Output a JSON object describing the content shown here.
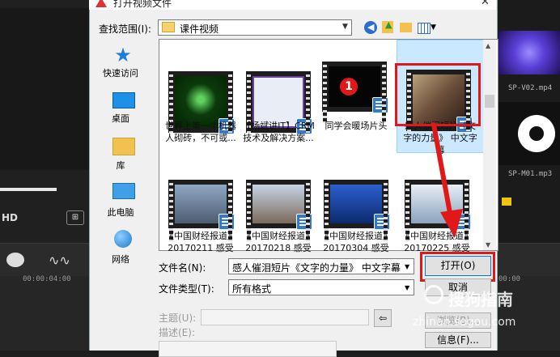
{
  "dialog": {
    "title": "打开视频文件",
    "lookin_label": "查找范围(I):",
    "lookin_value": "课件视频"
  },
  "places": [
    {
      "label": "快速访问",
      "icon": "star-icon"
    },
    {
      "label": "桌面",
      "icon": "desktop-icon"
    },
    {
      "label": "库",
      "icon": "library-icon"
    },
    {
      "label": "此电脑",
      "icon": "computer-icon"
    },
    {
      "label": "网络",
      "icon": "network-icon"
    }
  ],
  "files_row1": [
    {
      "name": "世界上第一个机器人砌砖，不可或...",
      "thumb": "green"
    },
    {
      "name": "【杨斌讲IT】CRM技术及解决方案...",
      "thumb": "screen"
    },
    {
      "name": "同学会暖场片头",
      "thumb": "red-one"
    },
    {
      "name": "感人催泪短片《文字的力量》 中文字幕",
      "thumb": "people"
    }
  ],
  "files_row2": [
    {
      "name": "《中国财经报道》20170211 感受",
      "thumb": "street"
    },
    {
      "name": "《中国财经报道》20170218 感受",
      "thumb": "city"
    },
    {
      "name": "《中国财经报道》20170304 感受",
      "thumb": "blue"
    },
    {
      "name": "《中国财经报道》20170225 感受",
      "thumb": "room"
    }
  ],
  "form": {
    "filename_label": "文件名(N):",
    "filename_value": "感人催泪短片《文字的力量》 中文字幕",
    "filetype_label": "文件类型(T):",
    "filetype_value": "所有格式",
    "subject_label": "主题(U):",
    "desc_label": "描述(E):"
  },
  "buttons": {
    "open": "打开(O)",
    "cancel": "取消",
    "browse": "浏览(B)...",
    "info": "信息(F)..."
  },
  "editor": {
    "hd_label": "HD",
    "timecode": "00:00:04:00",
    "timecode_right": "00:00",
    "media1": "SP-V02.mp4",
    "media2": "SP-M01.mp3"
  },
  "watermark": {
    "brand": "搜狗指南",
    "url": "zhinan.sogou.com"
  },
  "colors": {
    "highlight_red": "#e01818",
    "selection": "#cce8ff",
    "accent_blue": "#0078d7"
  }
}
